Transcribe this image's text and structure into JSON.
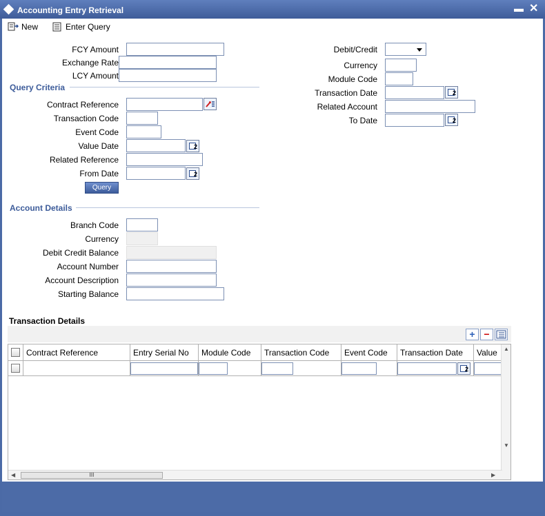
{
  "window": {
    "title": "Accounting Entry Retrieval",
    "minimize": "▬",
    "close": "✕"
  },
  "toolbar": {
    "new_label": "New",
    "enter_query_label": "Enter Query"
  },
  "form": {
    "fcy_amount": "FCY Amount",
    "exchange_rate": "Exchange Rate",
    "lcy_amount": "LCY Amount",
    "debit_credit": "Debit/Credit",
    "currency": "Currency",
    "module_code": "Module Code",
    "transaction_date": "Transaction Date",
    "related_account": "Related Account",
    "to_date": "To Date"
  },
  "query_criteria": {
    "title": "Query Criteria",
    "contract_reference": "Contract Reference",
    "transaction_code": "Transaction Code",
    "event_code": "Event Code",
    "value_date": "Value Date",
    "related_reference": "Related Reference",
    "from_date": "From Date",
    "query_button": "Query"
  },
  "account_details": {
    "title": "Account Details",
    "branch_code": "Branch Code",
    "currency": "Currency",
    "debit_credit_balance": "Debit Credit Balance",
    "account_number": "Account Number",
    "account_description": "Account Description",
    "starting_balance": "Starting Balance"
  },
  "transaction_details": {
    "title": "Transaction Details",
    "columns": [
      "Contract Reference",
      "Entry Serial No",
      "Module Code",
      "Transaction Code",
      "Event Code",
      "Transaction Date",
      "Value"
    ],
    "scroll_thumb": "III"
  }
}
